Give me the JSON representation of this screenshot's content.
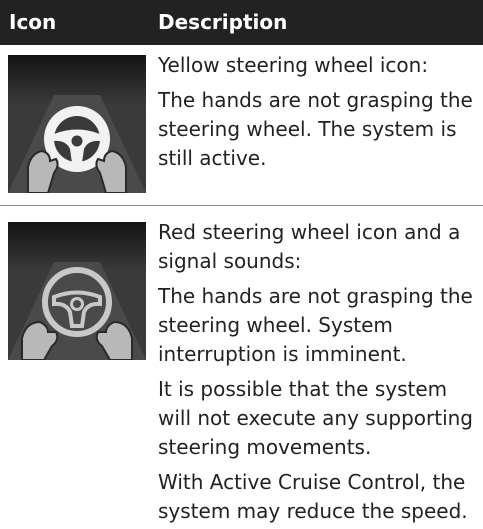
{
  "table": {
    "header": {
      "icon_label": "Icon",
      "description_label": "Description"
    },
    "rows": [
      {
        "icon": "steering-wheel-hands-off-yellow",
        "paragraphs": [
          "Yellow steering wheel icon:",
          "The hands are not grasping the steering wheel. The system is still active."
        ]
      },
      {
        "icon": "steering-wheel-hands-off-red",
        "paragraphs": [
          "Red steering wheel icon and a signal sounds:",
          "The hands are not grasping the steering wheel. System interruption is imminent.",
          "It is possible that the system will not execute any supporting steering movements.",
          "With Active Cruise Control, the system may reduce the speed."
        ]
      }
    ]
  },
  "colors": {
    "header_background": "#222222",
    "header_text": "#ffffff",
    "thumbnail_background": "#3c3c3c",
    "wheel_fill": "#f2f2f2",
    "hand_fill": "#b8b8b8"
  }
}
